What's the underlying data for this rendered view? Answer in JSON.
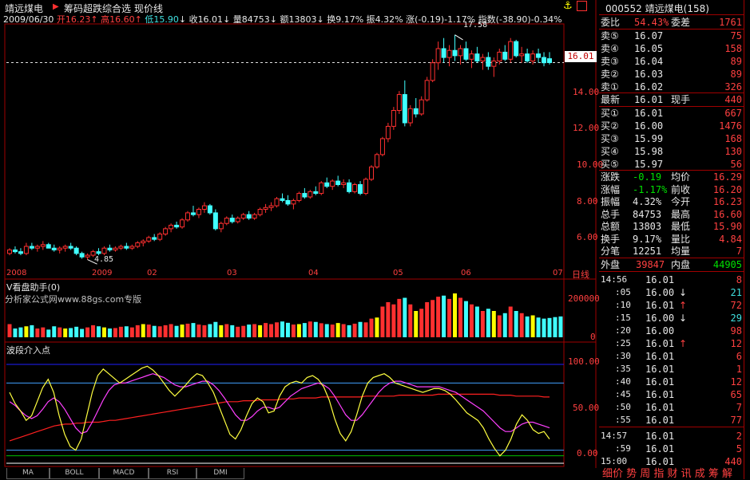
{
  "header": {
    "stock_name": "靖远煤电",
    "indicator_menu": "筹码超跌综合选",
    "price_line_label": "现价线",
    "info_line": {
      "date": "2009/06/30",
      "open_label": "开",
      "open": "16.23",
      "high_label": "高",
      "high": "16.60",
      "low_label": "低",
      "low": "15.90",
      "close_label": "收",
      "close": "16.01",
      "vol_label": "量",
      "vol": "84753",
      "amount_label": "额",
      "amount": "13803",
      "turnover_label": "换",
      "turnover": "9.17%",
      "amplitude_label": "振",
      "amplitude": "4.32%",
      "change_label": "涨",
      "change": "(-0.19)-1.17%",
      "index_label": "指数",
      "index": "(-38.90)-0.34%"
    }
  },
  "price_axis": {
    "ticks": [
      "16.01",
      "14.00",
      "12.00",
      "10.00",
      "8.00",
      "6.00"
    ],
    "current": "16.01"
  },
  "time_axis": {
    "labels": [
      "2008",
      "2009",
      "02",
      "03",
      "04",
      "05",
      "06",
      "07"
    ],
    "days_label": "日线"
  },
  "annotations": {
    "high_mark": "17.58",
    "low_mark": "4.85"
  },
  "volume_panel": {
    "title": "V看盘助手(0)",
    "watermark": "分析家公式网www.88gs.com专版",
    "ticks": [
      "200000",
      "0"
    ]
  },
  "osc_panel": {
    "title": "波段介入点",
    "ticks": [
      "100.00",
      "50.00",
      "0.00"
    ]
  },
  "bottom_tabs": [
    "MA",
    "BOLL",
    "MACD",
    "RSI",
    "DMI"
  ],
  "chart_data": {
    "type": "candlestick",
    "ylim": [
      4.2,
      18.2
    ],
    "candles": [
      [
        5.2,
        5.5,
        5.1,
        5.4
      ],
      [
        5.4,
        5.6,
        5.2,
        5.3
      ],
      [
        5.3,
        5.5,
        5.1,
        5.2
      ],
      [
        5.2,
        5.8,
        5.1,
        5.6
      ],
      [
        5.6,
        5.8,
        5.4,
        5.5
      ],
      [
        5.5,
        5.7,
        5.3,
        5.6
      ],
      [
        5.6,
        5.9,
        5.4,
        5.7
      ],
      [
        5.7,
        5.8,
        5.5,
        5.5
      ],
      [
        5.5,
        5.7,
        5.3,
        5.4
      ],
      [
        5.4,
        5.6,
        5.2,
        5.5
      ],
      [
        5.5,
        5.7,
        5.3,
        5.6
      ],
      [
        5.6,
        5.8,
        5.4,
        5.5
      ],
      [
        5.5,
        5.6,
        5.1,
        5.2
      ],
      [
        5.2,
        5.3,
        4.9,
        5.0
      ],
      [
        5.0,
        5.2,
        4.85,
        5.1
      ],
      [
        5.1,
        5.4,
        5.0,
        5.3
      ],
      [
        5.3,
        5.5,
        5.1,
        5.2
      ],
      [
        5.2,
        5.6,
        5.1,
        5.5
      ],
      [
        5.5,
        5.7,
        5.3,
        5.4
      ],
      [
        5.4,
        5.6,
        5.3,
        5.5
      ],
      [
        5.5,
        5.7,
        5.4,
        5.6
      ],
      [
        5.6,
        5.8,
        5.4,
        5.5
      ],
      [
        5.5,
        5.7,
        5.4,
        5.6
      ],
      [
        5.6,
        5.9,
        5.5,
        5.8
      ],
      [
        5.8,
        6.0,
        5.6,
        5.9
      ],
      [
        5.9,
        6.2,
        5.8,
        6.1
      ],
      [
        6.1,
        6.3,
        5.9,
        6.0
      ],
      [
        6.0,
        6.4,
        5.9,
        6.3
      ],
      [
        6.3,
        6.7,
        6.2,
        6.6
      ],
      [
        6.6,
        6.9,
        6.4,
        6.8
      ],
      [
        6.8,
        7.0,
        6.6,
        6.7
      ],
      [
        6.7,
        7.2,
        6.6,
        7.1
      ],
      [
        7.1,
        7.6,
        7.0,
        7.5
      ],
      [
        7.5,
        7.9,
        7.3,
        7.4
      ],
      [
        7.4,
        7.8,
        7.2,
        7.7
      ],
      [
        7.7,
        8.1,
        7.5,
        7.9
      ],
      [
        7.9,
        8.0,
        7.4,
        7.5
      ],
      [
        7.5,
        7.7,
        6.5,
        6.6
      ],
      [
        6.6,
        7.0,
        6.4,
        6.9
      ],
      [
        6.9,
        7.3,
        6.8,
        7.2
      ],
      [
        7.2,
        7.4,
        6.9,
        7.0
      ],
      [
        7.0,
        7.3,
        6.9,
        7.2
      ],
      [
        7.2,
        7.5,
        7.1,
        7.4
      ],
      [
        7.4,
        7.6,
        7.1,
        7.2
      ],
      [
        7.2,
        7.5,
        7.1,
        7.4
      ],
      [
        7.4,
        7.8,
        7.3,
        7.7
      ],
      [
        7.7,
        8.0,
        7.5,
        7.8
      ],
      [
        7.8,
        8.1,
        7.6,
        7.9
      ],
      [
        7.9,
        8.4,
        7.8,
        8.3
      ],
      [
        8.3,
        8.6,
        8.1,
        8.2
      ],
      [
        8.2,
        8.5,
        7.9,
        8.0
      ],
      [
        8.0,
        8.3,
        7.7,
        8.2
      ],
      [
        8.2,
        8.7,
        8.1,
        8.6
      ],
      [
        8.6,
        8.9,
        8.3,
        8.4
      ],
      [
        8.4,
        8.8,
        8.3,
        8.7
      ],
      [
        8.7,
        9.0,
        8.5,
        8.6
      ],
      [
        8.6,
        9.3,
        8.5,
        9.2
      ],
      [
        9.2,
        9.5,
        8.9,
        9.0
      ],
      [
        9.0,
        9.4,
        8.8,
        9.3
      ],
      [
        9.3,
        9.6,
        9.0,
        9.1
      ],
      [
        9.1,
        9.4,
        8.9,
        9.2
      ],
      [
        9.2,
        9.4,
        8.6,
        8.7
      ],
      [
        8.7,
        9.2,
        8.6,
        9.1
      ],
      [
        9.1,
        9.3,
        8.5,
        8.6
      ],
      [
        8.6,
        9.5,
        8.5,
        9.4
      ],
      [
        9.4,
        10.2,
        9.3,
        10.1
      ],
      [
        10.1,
        10.9,
        10.0,
        10.8
      ],
      [
        10.8,
        11.8,
        10.7,
        11.7
      ],
      [
        11.7,
        12.6,
        11.5,
        12.4
      ],
      [
        12.4,
        13.5,
        12.2,
        13.3
      ],
      [
        13.3,
        14.4,
        13.1,
        14.2
      ],
      [
        14.2,
        15.0,
        12.4,
        12.6
      ],
      [
        12.6,
        13.6,
        12.4,
        13.4
      ],
      [
        13.4,
        14.0,
        12.9,
        13.1
      ],
      [
        13.1,
        14.1,
        13.0,
        13.9
      ],
      [
        13.9,
        15.2,
        13.8,
        15.0
      ],
      [
        15.0,
        16.2,
        14.9,
        16.0
      ],
      [
        16.0,
        17.2,
        15.6,
        16.8
      ],
      [
        16.8,
        17.4,
        16.0,
        16.3
      ],
      [
        16.3,
        17.0,
        15.8,
        16.7
      ],
      [
        16.7,
        17.58,
        16.1,
        16.4
      ],
      [
        16.4,
        17.0,
        15.9,
        16.8
      ],
      [
        16.8,
        17.2,
        16.1,
        16.2
      ],
      [
        16.2,
        16.7,
        15.7,
        16.5
      ],
      [
        16.5,
        16.9,
        16.0,
        16.1
      ],
      [
        16.1,
        16.5,
        15.6,
        16.3
      ],
      [
        16.3,
        16.6,
        15.6,
        15.8
      ],
      [
        15.8,
        16.3,
        15.2,
        16.1
      ],
      [
        16.1,
        16.8,
        15.9,
        16.6
      ],
      [
        16.6,
        17.0,
        16.1,
        16.2
      ],
      [
        16.2,
        17.4,
        16.0,
        17.2
      ],
      [
        17.2,
        17.3,
        16.3,
        16.4
      ],
      [
        16.4,
        16.9,
        16.0,
        16.5
      ],
      [
        16.5,
        16.8,
        16.0,
        16.1
      ],
      [
        16.1,
        16.7,
        15.9,
        16.5
      ],
      [
        16.5,
        16.8,
        16.0,
        16.3
      ],
      [
        16.3,
        16.6,
        15.8,
        16.0
      ],
      [
        16.23,
        16.6,
        15.9,
        16.01
      ]
    ],
    "volumes": [
      60,
      40,
      45,
      50,
      55,
      40,
      45,
      35,
      50,
      45,
      40,
      42,
      48,
      38,
      45,
      55,
      50,
      45,
      40,
      42,
      48,
      50,
      45,
      55,
      60,
      58,
      52,
      50,
      55,
      60,
      52,
      58,
      62,
      65,
      58,
      55,
      60,
      70,
      55,
      60,
      55,
      48,
      52,
      58,
      60,
      55,
      65,
      60,
      68,
      72,
      66,
      58,
      60,
      65,
      72,
      70,
      64,
      60,
      58,
      65,
      60,
      55,
      62,
      70,
      68,
      85,
      90,
      140,
      160,
      150,
      175,
      180,
      150,
      120,
      130,
      160,
      170,
      185,
      190,
      175,
      200,
      180,
      165,
      150,
      140,
      120,
      130,
      120,
      100,
      110,
      140,
      120,
      110,
      95,
      100,
      90,
      85,
      88,
      92,
      95
    ],
    "osc_fast": [
      70,
      58,
      50,
      40,
      45,
      60,
      75,
      84,
      70,
      45,
      25,
      12,
      8,
      20,
      45,
      70,
      88,
      95,
      90,
      85,
      80,
      84,
      88,
      92,
      96,
      98,
      94,
      88,
      80,
      72,
      66,
      72,
      78,
      85,
      90,
      88,
      80,
      70,
      55,
      40,
      25,
      20,
      30,
      45,
      58,
      64,
      60,
      48,
      50,
      66,
      76,
      80,
      82,
      80,
      86,
      88,
      84,
      76,
      62,
      42,
      26,
      18,
      28,
      46,
      66,
      80,
      86,
      88,
      90,
      86,
      80,
      78,
      76,
      74,
      72,
      70,
      72,
      74,
      74,
      72,
      68,
      62,
      55,
      48,
      44,
      40,
      32,
      20,
      10,
      2,
      8,
      20,
      36,
      46,
      40,
      30,
      26,
      28,
      20
    ],
    "osc_slow": [
      60,
      56,
      50,
      45,
      42,
      45,
      52,
      60,
      64,
      60,
      52,
      42,
      32,
      26,
      28,
      38,
      50,
      62,
      72,
      78,
      80,
      80,
      82,
      84,
      86,
      88,
      90,
      88,
      86,
      82,
      78,
      76,
      76,
      78,
      80,
      82,
      82,
      78,
      72,
      64,
      55,
      46,
      40,
      40,
      44,
      50,
      54,
      54,
      52,
      54,
      60,
      66,
      70,
      74,
      76,
      78,
      80,
      78,
      74,
      66,
      56,
      46,
      40,
      40,
      46,
      54,
      62,
      70,
      76,
      80,
      82,
      82,
      80,
      78,
      76,
      76,
      76,
      76,
      76,
      74,
      72,
      70,
      66,
      62,
      58,
      54,
      50,
      44,
      38,
      32,
      28,
      28,
      32,
      36,
      38,
      38,
      36,
      34,
      32
    ],
    "osc_red": [
      18,
      20,
      22,
      24,
      26,
      28,
      30,
      32,
      34,
      35,
      36,
      36,
      37,
      37,
      38,
      38,
      38,
      39,
      40,
      40,
      41,
      42,
      43,
      44,
      45,
      46,
      47,
      48,
      49,
      50,
      51,
      52,
      53,
      54,
      55,
      56,
      57,
      58,
      59,
      60,
      60,
      60,
      61,
      61,
      61,
      62,
      62,
      62,
      62,
      63,
      63,
      63,
      64,
      64,
      64,
      64,
      65,
      65,
      65,
      65,
      65,
      65,
      65,
      65,
      66,
      66,
      66,
      66,
      66,
      66,
      67,
      67,
      67,
      67,
      67,
      67,
      67,
      68,
      68,
      68,
      68,
      68,
      68,
      68,
      68,
      68,
      68,
      68,
      67,
      67,
      67,
      66,
      66,
      66,
      66,
      66,
      65,
      65
    ]
  },
  "quote_panel": {
    "code": "000552",
    "name": "靖远煤电",
    "count": "(158)",
    "wb_label": "委比",
    "wb": "54.43%",
    "wc_label": "委差",
    "wc": "1761",
    "sells": [
      {
        "label": "卖⑤",
        "price": "16.07",
        "vol": "75"
      },
      {
        "label": "卖④",
        "price": "16.05",
        "vol": "158"
      },
      {
        "label": "卖③",
        "price": "16.04",
        "vol": "89"
      },
      {
        "label": "卖②",
        "price": "16.03",
        "vol": "89"
      },
      {
        "label": "卖①",
        "price": "16.02",
        "vol": "326"
      }
    ],
    "last_label": "最新",
    "last": "16.01",
    "hand_label": "现手",
    "hand": "440",
    "buys": [
      {
        "label": "买①",
        "price": "16.01",
        "vol": "667"
      },
      {
        "label": "买②",
        "price": "16.00",
        "vol": "1476"
      },
      {
        "label": "买③",
        "price": "15.99",
        "vol": "168"
      },
      {
        "label": "买④",
        "price": "15.98",
        "vol": "130"
      },
      {
        "label": "买⑤",
        "price": "15.97",
        "vol": "56"
      }
    ],
    "stats": [
      {
        "l1": "涨跌",
        "v1": "-0.19",
        "l2": "均价",
        "v2": "16.29"
      },
      {
        "l1": "涨幅",
        "v1": "-1.17%",
        "l2": "前收",
        "v2": "16.20"
      },
      {
        "l1": "振幅",
        "v1": "4.32%",
        "l2": "今开",
        "v2": "16.23"
      },
      {
        "l1": "总手",
        "v1": "84753",
        "l2": "最高",
        "v2": "16.60"
      },
      {
        "l1": "总额",
        "v1": "13803",
        "l2": "最低",
        "v2": "15.90"
      },
      {
        "l1": "换手",
        "v1": "9.17%",
        "l2": "量比",
        "v2": "4.84"
      },
      {
        "l1": "分笔",
        "v1": "12251",
        "l2": "均量",
        "v2": "7"
      }
    ],
    "outer_label": "外盘",
    "outer": "39847",
    "inner_label": "内盘",
    "inner": "44905",
    "ticks": [
      {
        "t": "14:56",
        "p": "16.01",
        "a": "",
        "v": "8"
      },
      {
        "t": ":05",
        "p": "16.00",
        "a": "↓",
        "v": "21"
      },
      {
        "t": ":10",
        "p": "16.01",
        "a": "↑",
        "v": "72"
      },
      {
        "t": ":15",
        "p": "16.00",
        "a": "↓",
        "v": "29"
      },
      {
        "t": ":20",
        "p": "16.00",
        "a": "",
        "v": "98"
      },
      {
        "t": ":25",
        "p": "16.01",
        "a": "↑",
        "v": "12"
      },
      {
        "t": ":30",
        "p": "16.01",
        "a": "",
        "v": "6"
      },
      {
        "t": ":35",
        "p": "16.01",
        "a": "",
        "v": "1"
      },
      {
        "t": ":40",
        "p": "16.01",
        "a": "",
        "v": "12"
      },
      {
        "t": ":45",
        "p": "16.01",
        "a": "",
        "v": "65"
      },
      {
        "t": ":50",
        "p": "16.01",
        "a": "",
        "v": "7"
      },
      {
        "t": ":55",
        "p": "16.01",
        "a": "",
        "v": "77"
      },
      {
        "t": "14:57",
        "p": "16.01",
        "a": "",
        "v": "2"
      },
      {
        "t": ":59",
        "p": "16.01",
        "a": "",
        "v": "5"
      },
      {
        "t": "15:00",
        "p": "16.01",
        "a": "",
        "v": "440"
      }
    ],
    "bottom_menu": "细价 势 周 指 财 讯 成 筹 解"
  }
}
